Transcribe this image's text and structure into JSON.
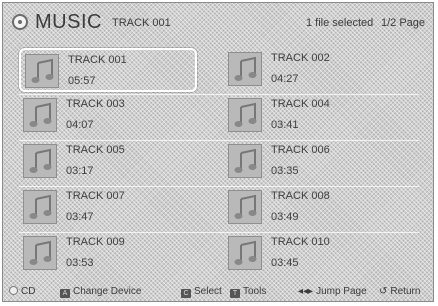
{
  "header": {
    "app_title": "MUSIC",
    "current_track": "TRACK 001",
    "selection_status": "1 file selected",
    "page_indicator": "1/2 Page"
  },
  "tracks": [
    {
      "name": "TRACK 001",
      "duration": "05:57",
      "focused": true
    },
    {
      "name": "TRACK 002",
      "duration": "04:27",
      "focused": false
    },
    {
      "name": "TRACK 003",
      "duration": "04:07",
      "focused": false
    },
    {
      "name": "TRACK 004",
      "duration": "03:41",
      "focused": false
    },
    {
      "name": "TRACK 005",
      "duration": "03:17",
      "focused": false
    },
    {
      "name": "TRACK 006",
      "duration": "03:35",
      "focused": false
    },
    {
      "name": "TRACK 007",
      "duration": "03:47",
      "focused": false
    },
    {
      "name": "TRACK 008",
      "duration": "03:49",
      "focused": false
    },
    {
      "name": "TRACK 009",
      "duration": "03:53",
      "focused": false
    },
    {
      "name": "TRACK 010",
      "duration": "03:45",
      "focused": false
    }
  ],
  "footer": {
    "cd": "CD",
    "change_device": "Change Device",
    "select": "Select",
    "tools": "Tools",
    "jump_page": "Jump Page",
    "return": "Return"
  }
}
